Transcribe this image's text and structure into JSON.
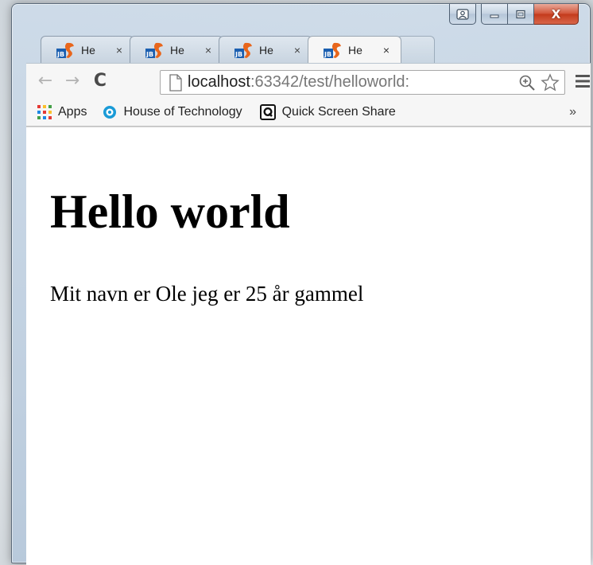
{
  "tabs": [
    {
      "title": "He",
      "close": "×",
      "active": false
    },
    {
      "title": "He",
      "close": "×",
      "active": false
    },
    {
      "title": "He",
      "close": "×",
      "active": false
    },
    {
      "title": "He",
      "close": "×",
      "active": true
    }
  ],
  "caption": {
    "close_glyph": "X"
  },
  "toolbar": {
    "back": "←",
    "forward": "→",
    "reload": "C",
    "url_host": "localhost",
    "url_rest": ":63342/test/helloworld:"
  },
  "bookmarks": {
    "apps": "Apps",
    "house": "House of Technology",
    "quick": "Quick Screen Share",
    "more": "»"
  },
  "page": {
    "heading": "Hello world",
    "paragraph": "Mit navn er Ole jeg er 25 år gammel"
  },
  "colors": {
    "accent_close": "#c43b1c",
    "favicon_orange": "#e8661c",
    "favicon_blue": "#1b5fb0"
  }
}
